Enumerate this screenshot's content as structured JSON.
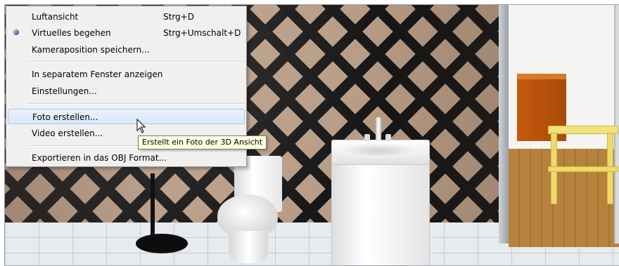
{
  "menu": {
    "items": [
      {
        "label": "Luftansicht",
        "shortcut": "Strg+D",
        "checked": false
      },
      {
        "label": "Virtuelles begehen",
        "shortcut": "Strg+Umschalt+D",
        "checked": true
      },
      {
        "label": "Kameraposition speichern...",
        "shortcut": ""
      },
      {
        "label": "In separatem Fenster anzeigen",
        "shortcut": ""
      },
      {
        "label": "Einstellungen...",
        "shortcut": ""
      },
      {
        "label": "Foto erstellen...",
        "shortcut": "",
        "highlighted": true
      },
      {
        "label": "Video erstellen...",
        "shortcut": ""
      },
      {
        "label": "Exportieren in das OBJ Format...",
        "shortcut": ""
      }
    ]
  },
  "tooltip": {
    "text": "Erstellt ein Foto der 3D Ansicht"
  },
  "icons": {
    "radio": "radio-selected-icon",
    "cursor": "mouse-pointer-icon"
  },
  "colors": {
    "menu_background": "#f0f0f0",
    "highlight_border": "#a8c8ea",
    "tooltip_background": "#ffffe1"
  }
}
